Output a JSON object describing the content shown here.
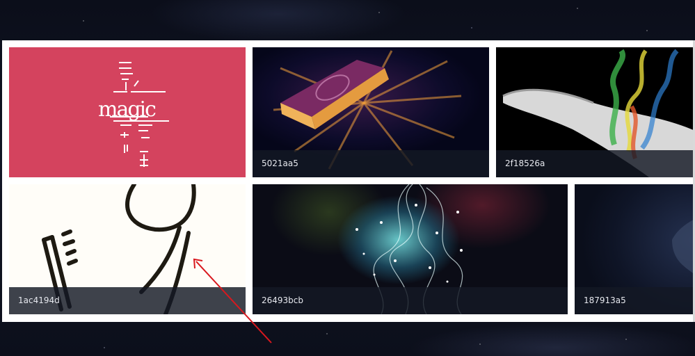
{
  "tiles": [
    {
      "id": "magic",
      "image_text": "magic"
    },
    {
      "id": "5021aa5",
      "caption": "5021aa5"
    },
    {
      "id": "2f18526a",
      "caption": "2f18526a"
    },
    {
      "id": "1ac4194d",
      "caption": "1ac4194d"
    },
    {
      "id": "26493bcb",
      "caption": "26493bcb"
    },
    {
      "id": "187913a5",
      "caption": "187913a5"
    }
  ],
  "colors": {
    "magic_tile": "#d4435e",
    "caption_bar": "#141824",
    "annotation_arrow": "#d9181e"
  },
  "icons": {
    "annotation": "red-arrow-icon"
  }
}
